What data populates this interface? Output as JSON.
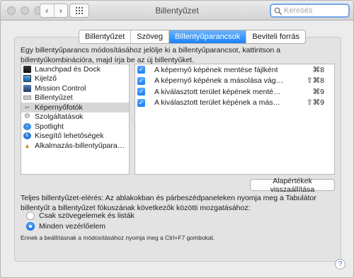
{
  "window": {
    "title": "Billentyűzet"
  },
  "toolbar": {
    "back_icon": "chevron-left-icon",
    "forward_icon": "chevron-right-icon",
    "grid_icon": "grid-icon",
    "back_glyph": "‹",
    "forward_glyph": "›"
  },
  "search": {
    "placeholder": "Keresés",
    "value": ""
  },
  "tabs": [
    {
      "label": "Billentyűzet",
      "active": false
    },
    {
      "label": "Szöveg",
      "active": false
    },
    {
      "label": "Billentyűparancsok",
      "active": true
    },
    {
      "label": "Beviteli forrás",
      "active": false
    }
  ],
  "description": "Egy billentyűparancs módosításához jelölje ki a billentyűparancsot, kattintson a billentyűkombinációra, majd írja be az új billentyűket.",
  "categories": [
    {
      "label": "Launchpad és Dock",
      "icon": "launchpad-icon",
      "selected": false
    },
    {
      "label": "Kijelző",
      "icon": "display-icon",
      "selected": false
    },
    {
      "label": "Mission Control",
      "icon": "mission-control-icon",
      "selected": false
    },
    {
      "label": "Billentyűzet",
      "icon": "keyboard-icon",
      "selected": false
    },
    {
      "label": "Képernyőfotók",
      "icon": "camera-icon",
      "selected": true
    },
    {
      "label": "Szolgáltatások",
      "icon": "gear-icon",
      "selected": false
    },
    {
      "label": "Spotlight",
      "icon": "spotlight-icon",
      "selected": false
    },
    {
      "label": "Kisegítő lehetőségek",
      "icon": "accessibility-icon",
      "selected": false
    },
    {
      "label": "Alkalmazás-billentyűparа…",
      "icon": "app-shortcuts-icon",
      "selected": false
    }
  ],
  "shortcuts": [
    {
      "label": "A képernyő képének mentése fájlként",
      "keys": "⌘8",
      "checked": true
    },
    {
      "label": "A képernyő képének a másolása vág…",
      "keys": "⇧⌘8",
      "checked": true
    },
    {
      "label": "A kiválasztott terület képének menté…",
      "keys": "⌘9",
      "checked": true
    },
    {
      "label": "A kiválasztott terület képének a más…",
      "keys": "⇧⌘9",
      "checked": true
    }
  ],
  "restore_button": "Alapértékek visszaállítása",
  "full_keyboard_access": {
    "text": "Teljes billentyűzet-elérés: Az ablakokban és párbeszédpaneleken nyomja meg a Tabulátor billentyűt a billentyűzet fókuszának következők közötti mozgatásához:",
    "options": [
      {
        "label": "Csak szövegelemek és listák",
        "selected": false
      },
      {
        "label": "Minden vezérlőelem",
        "selected": true
      }
    ]
  },
  "note": "Ennek a beállításnak a módosításához nyomja meg a Ctrl+F7 gombokat.",
  "help": "?"
}
